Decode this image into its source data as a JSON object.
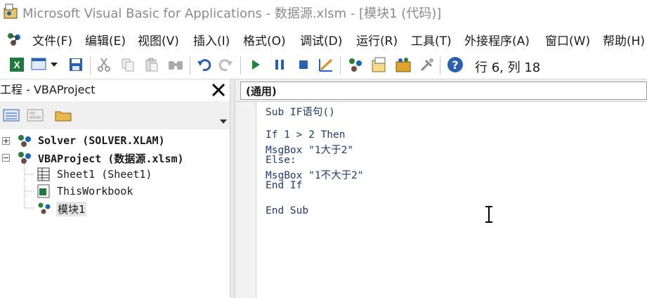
{
  "window": {
    "title": "Microsoft Visual Basic for Applications - 数据源.xlsm - [模块1 (代码)]"
  },
  "menu": {
    "items": [
      {
        "label": "文件(F)"
      },
      {
        "label": "编辑(E)"
      },
      {
        "label": "视图(V)"
      },
      {
        "label": "插入(I)"
      },
      {
        "label": "格式(O)"
      },
      {
        "label": "调试(D)"
      },
      {
        "label": "运行(R)"
      },
      {
        "label": "工具(T)"
      },
      {
        "label": "外接程序(A)"
      },
      {
        "label": "窗口(W)"
      },
      {
        "label": "帮助(H)"
      }
    ]
  },
  "toolbar": {
    "cursor_position": "行 6, 列 18",
    "icons": [
      "excel-icon",
      "insert-userform-icon",
      "dropdown-arrow-icon",
      "save-icon",
      "cut-icon",
      "copy-icon",
      "paste-icon",
      "find-icon",
      "undo-icon",
      "redo-icon",
      "run-icon",
      "break-icon",
      "reset-icon",
      "design-mode-icon",
      "project-explorer-icon",
      "properties-window-icon",
      "object-browser-icon",
      "toolbox-icon",
      "help-icon"
    ]
  },
  "project": {
    "title": "工程 - VBAProject",
    "tree": [
      {
        "label": "Solver (SOLVER.XLAM)",
        "bold": true
      },
      {
        "label": "VBAProject (数据源.xlsm)",
        "bold": true
      },
      {
        "label": "Sheet1 (Sheet1)",
        "bold": false
      },
      {
        "label": "ThisWorkbook",
        "bold": false
      },
      {
        "label": "模块1",
        "bold": false,
        "selected": true
      }
    ]
  },
  "code": {
    "object_combo": "(通用)",
    "lines": [
      "Sub IF语句()",
      "",
      "If 1 > 2 Then",
      "MsgBox \"1大于2\"",
      "Else:",
      "MsgBox \"1不大于2\"",
      "End If",
      "",
      "End Sub"
    ]
  },
  "colors": {
    "code_text": "#1f3a7a",
    "vba_green": "#1e7a3c",
    "run_green": "#1a8a2e",
    "blue": "#2b5fb3"
  }
}
